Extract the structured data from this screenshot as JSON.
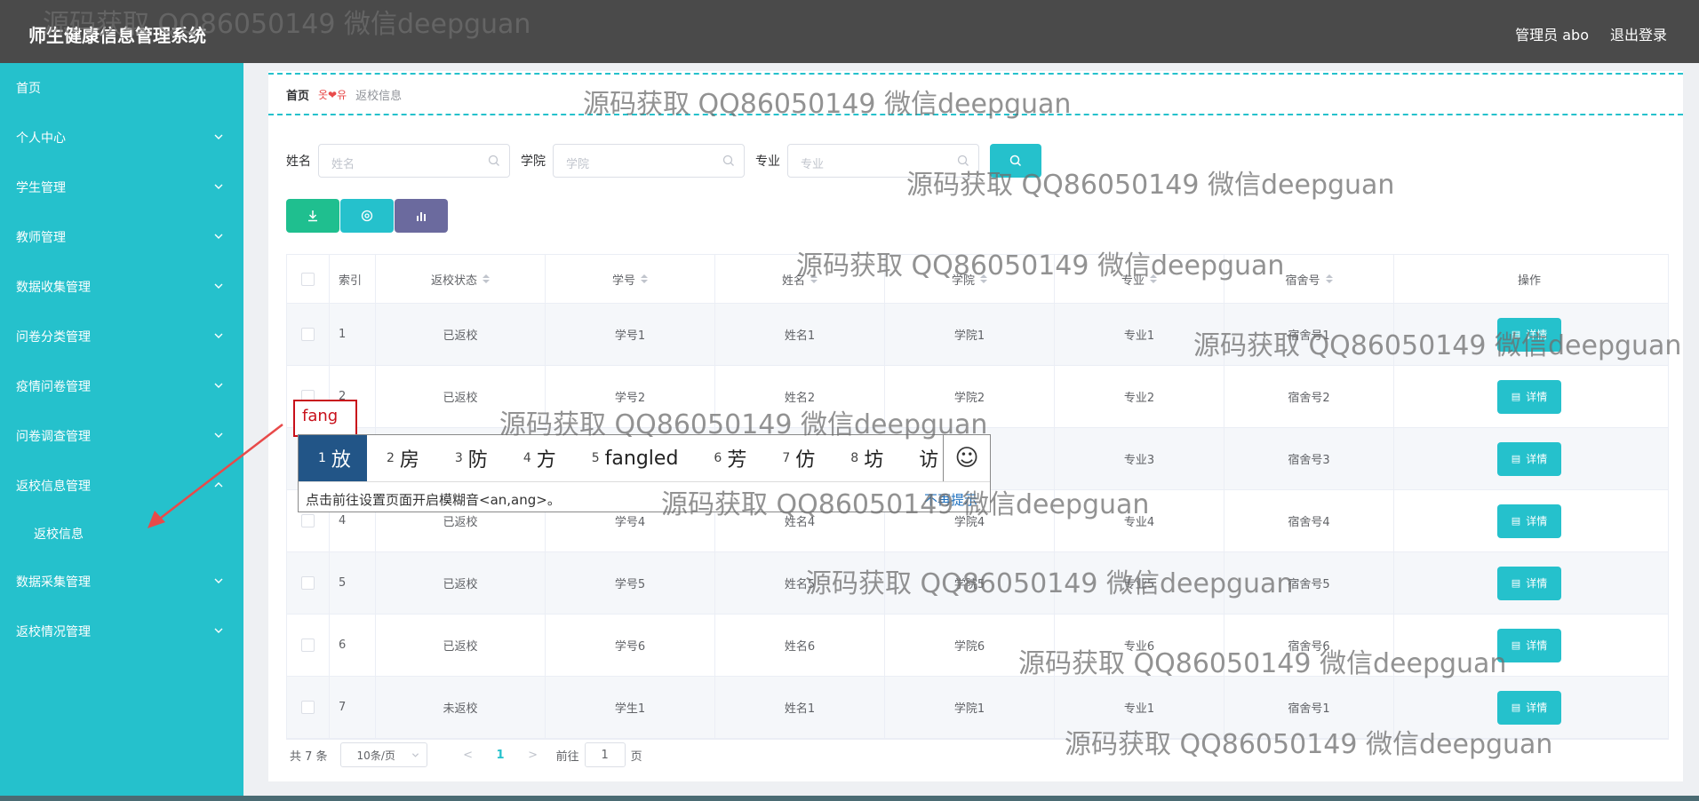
{
  "header": {
    "title": "师生健康信息管理系统",
    "user": "管理员 abo",
    "logout": "退出登录"
  },
  "sidebar": {
    "items": [
      {
        "label": "首页",
        "chevron": false
      },
      {
        "label": "个人中心",
        "chevron": "down"
      },
      {
        "label": "学生管理",
        "chevron": "down"
      },
      {
        "label": "教师管理",
        "chevron": "down"
      },
      {
        "label": "数据收集管理",
        "chevron": "down"
      },
      {
        "label": "问卷分类管理",
        "chevron": "down"
      },
      {
        "label": "疫情问卷管理",
        "chevron": "down"
      },
      {
        "label": "问卷调查管理",
        "chevron": "down"
      },
      {
        "label": "返校信息管理",
        "chevron": "up"
      },
      {
        "label": "返校信息",
        "chevron": false,
        "sub": true
      },
      {
        "label": "数据采集管理",
        "chevron": "down"
      },
      {
        "label": "返校情况管理",
        "chevron": "down"
      }
    ]
  },
  "breadcrumb": {
    "home": "首页",
    "separator": "옷❤유",
    "current": "返校信息"
  },
  "search": {
    "name_label": "姓名",
    "name_placeholder": "姓名",
    "college_label": "学院",
    "college_placeholder": "学院",
    "major_label": "专业",
    "major_placeholder": "专业"
  },
  "actions": [
    {
      "name": "download-button",
      "color": "#1fbf8f",
      "icon": "download-icon"
    },
    {
      "name": "print-button",
      "color": "#25c1cc",
      "icon": "print-icon"
    },
    {
      "name": "chart-button",
      "color": "#6b6a9e",
      "icon": "bar-chart-icon"
    }
  ],
  "table": {
    "columns": [
      "索引",
      "返校状态",
      "学号",
      "姓名",
      "学院",
      "专业",
      "宿舍号",
      "操作"
    ],
    "rows": [
      {
        "idx": "1",
        "status": "已返校",
        "sid": "学号1",
        "name": "姓名1",
        "college": "学院1",
        "major": "专业1",
        "dorm": "宿舍号1",
        "op": "详情"
      },
      {
        "idx": "2",
        "status": "已返校",
        "sid": "学号2",
        "name": "姓名2",
        "college": "学院2",
        "major": "专业2",
        "dorm": "宿舍号2",
        "op": "详情"
      },
      {
        "idx": "",
        "status": "",
        "sid": "",
        "name": "",
        "college": "",
        "major": "专业3",
        "dorm": "宿舍号3",
        "op": "详情"
      },
      {
        "idx": "4",
        "status": "已返校",
        "sid": "学号4",
        "name": "姓名4",
        "college": "学院4",
        "major": "专业4",
        "dorm": "宿舍号4",
        "op": "详情"
      },
      {
        "idx": "5",
        "status": "已返校",
        "sid": "学号5",
        "name": "姓名5",
        "college": "学院5",
        "major": "专业5",
        "dorm": "宿舍号5",
        "op": "详情"
      },
      {
        "idx": "6",
        "status": "已返校",
        "sid": "学号6",
        "name": "姓名6",
        "college": "学院6",
        "major": "专业6",
        "dorm": "宿舍号6",
        "op": "详情"
      },
      {
        "idx": "7",
        "status": "未返校",
        "sid": "学生1",
        "name": "姓名1",
        "college": "学院1",
        "major": "专业1",
        "dorm": "宿舍号1",
        "op": "详情"
      }
    ]
  },
  "pagination": {
    "total": "共 7 条",
    "page_size": "10条/页",
    "current_page": "1",
    "goto_label": "前往",
    "goto_value": "1",
    "page_unit": "页"
  },
  "ime": {
    "composition": "fang",
    "candidates": [
      {
        "n": "1",
        "text": "放"
      },
      {
        "n": "2",
        "text": "房"
      },
      {
        "n": "3",
        "text": "防"
      },
      {
        "n": "4",
        "text": "方"
      },
      {
        "n": "5",
        "text": "fangled"
      },
      {
        "n": "6",
        "text": "芳"
      },
      {
        "n": "7",
        "text": "仿"
      },
      {
        "n": "8",
        "text": "坊"
      },
      {
        "n": "",
        "text": "访"
      }
    ],
    "emoji": "☺",
    "hint": "点击前往设置页面开启模糊音<an,ang>。",
    "hint_link": "不再提示"
  },
  "watermark": "源码获取 QQ86050149 微信deepguan",
  "colors": {
    "accent": "#25c1cc",
    "header": "#4a4a4a",
    "ime_selected": "#225587",
    "arrow": "#e84a4a"
  }
}
